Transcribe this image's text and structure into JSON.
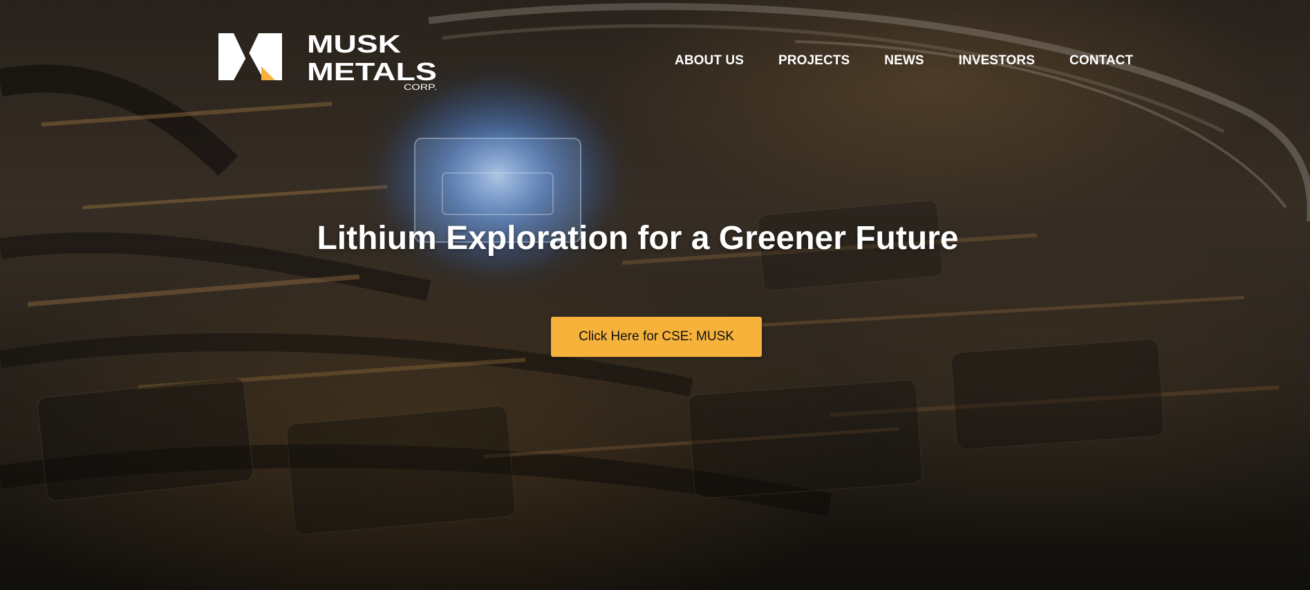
{
  "brand": {
    "logo_icon": "musk-metals-m-mark",
    "name_line1": "MUSK",
    "name_line2": "METALS",
    "name_line3": "CORP.",
    "accent_color": "#f7b23b"
  },
  "nav": {
    "items": [
      {
        "label": "ABOUT US"
      },
      {
        "label": "PROJECTS"
      },
      {
        "label": "NEWS"
      },
      {
        "label": "INVESTORS"
      },
      {
        "label": "CONTACT"
      }
    ]
  },
  "hero": {
    "title": "Lithium Exploration for a Greener Future",
    "cta_label": "Click Here for CSE: MUSK",
    "cta_color": "#f7b23b",
    "background": "dark industrial battery-cell artwork with glowing blue cube"
  }
}
